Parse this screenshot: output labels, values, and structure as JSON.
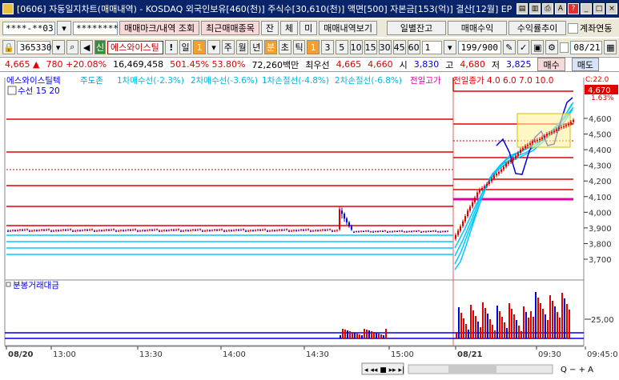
{
  "title": {
    "text": "[0606] 자동일지차트(매매내역) - KOSDAQ 외국인보유[460(천)] 주식수[30,610(천)] 액면[500] 자본금[153(억)] 결산[12월] EP"
  },
  "toolbar1": {
    "account": "****-**03",
    "password": "********",
    "mark_btn": "매매마크/내역 조회",
    "recent_btn": "최근매매종목",
    "jan": "잔",
    "che": "체",
    "mi": "미",
    "history_btn": "매매내역보기",
    "balance_btn": "일별잔고",
    "profit_btn": "매매수익",
    "rate_btn": "수익률추이",
    "continuous_label": "계좌연동"
  },
  "toolbar2": {
    "code": "365330",
    "shin": "신",
    "stock_name": "에스와이스틸",
    "excl": "!",
    "day": "일",
    "one": "1",
    "week": "주",
    "month": "월",
    "year": "년",
    "min": "분",
    "sec": "초",
    "tick": "틱",
    "periods": [
      "1",
      "3",
      "5",
      "10",
      "15",
      "30",
      "45",
      "60"
    ],
    "period_value": "1",
    "page": "199/900",
    "date": "08/21"
  },
  "quote": {
    "price": "4,665 ▲",
    "change": "780 +20.08%",
    "volume": "16,469,458",
    "ratio": "501.45% 53.80%",
    "amount": "72,260백만",
    "best_ask_label": "최우선",
    "best_ask": "4,665",
    "best_bid": "4,660",
    "open_label": "시",
    "open": "3,830",
    "high_label": "고",
    "high": "4,680",
    "low_label": "저",
    "low": "3,825",
    "buy": "매수",
    "sell": "매도"
  },
  "legend": {
    "name": "에스와이스틸텍",
    "i1": "주도존",
    "i2": "1차매수선(-2.3%)",
    "i3": "2차매수선(-3.6%)",
    "i4": "1차손절선(-4.8%)",
    "i5": "2차손절선(-6.8%)",
    "i6": "전일고가",
    "i7": "전일종가 4.0 6.0 7.0 10.0",
    "line2": "수선 15 20"
  },
  "price_axis": {
    "labels": [
      "4,600",
      "4,500",
      "4,400",
      "4,300",
      "4,200",
      "4,100",
      "4,000",
      "3,900",
      "3,800",
      "3,700"
    ],
    "current": "4,670",
    "pct": "1.63%",
    "topcut": "C:22.0"
  },
  "volume_panel": {
    "title": "분봉거래대금",
    "label": "25,00"
  },
  "time_axis": {
    "labels": [
      "08/20",
      "13:00",
      "13:30",
      "14:00",
      "14:30",
      "15:00",
      "08/21",
      "09:30",
      "09:45:0"
    ]
  },
  "bottom": {
    "nav": "◂ ◂◂ ■ ▸▸ ▸|",
    "controls": "Q − + A"
  },
  "colors": {
    "up": "#e00000",
    "down": "#0000e0",
    "resist": "#e00000",
    "support": "#00c8ff",
    "magenta": "#e000a0"
  }
}
